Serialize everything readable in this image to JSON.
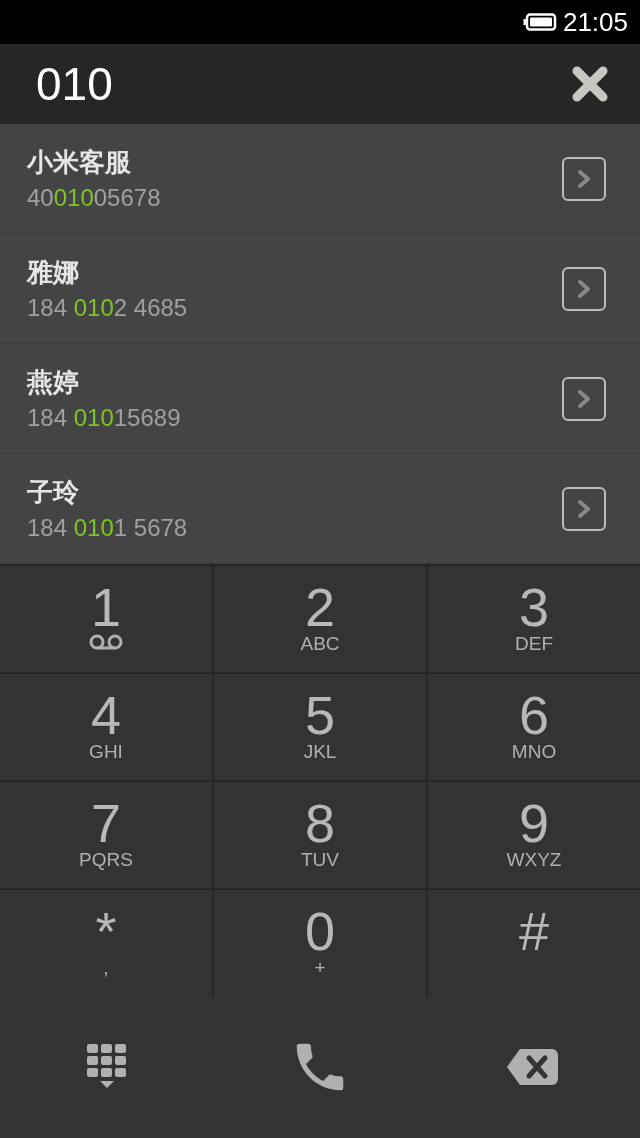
{
  "status_bar": {
    "time": "21:05"
  },
  "dial_field": {
    "value": "010"
  },
  "results": [
    {
      "name": "小米客服",
      "number_parts": [
        {
          "text": "40",
          "highlighted": false
        },
        {
          "text": "010",
          "highlighted": true
        },
        {
          "text": "05678",
          "highlighted": false
        }
      ]
    },
    {
      "name": "雅娜",
      "number_parts": [
        {
          "text": "184 ",
          "highlighted": false
        },
        {
          "text": "010",
          "highlighted": true
        },
        {
          "text": "2 4685",
          "highlighted": false
        }
      ]
    },
    {
      "name": "燕婷",
      "number_parts": [
        {
          "text": "184 ",
          "highlighted": false
        },
        {
          "text": "010",
          "highlighted": true
        },
        {
          "text": "15689",
          "highlighted": false
        }
      ]
    },
    {
      "name": "子玲",
      "number_parts": [
        {
          "text": "184 ",
          "highlighted": false
        },
        {
          "text": "010",
          "highlighted": true
        },
        {
          "text": "1 5678",
          "highlighted": false
        }
      ]
    }
  ],
  "keypad": [
    {
      "key": "1",
      "kind": "voicemail"
    },
    {
      "key": "2",
      "kind": "letters",
      "sub": "ABC"
    },
    {
      "key": "3",
      "kind": "letters",
      "sub": "DEF"
    },
    {
      "key": "4",
      "kind": "letters",
      "sub": "GHI"
    },
    {
      "key": "5",
      "kind": "letters",
      "sub": "JKL"
    },
    {
      "key": "6",
      "kind": "letters",
      "sub": "MNO"
    },
    {
      "key": "7",
      "kind": "letters",
      "sub": "PQRS"
    },
    {
      "key": "8",
      "kind": "letters",
      "sub": "TUV"
    },
    {
      "key": "9",
      "kind": "letters",
      "sub": "WXYZ"
    },
    {
      "key": "*",
      "kind": "letters",
      "sub": ","
    },
    {
      "key": "0",
      "kind": "letters",
      "sub": "+"
    },
    {
      "key": "#",
      "kind": "plain"
    }
  ]
}
